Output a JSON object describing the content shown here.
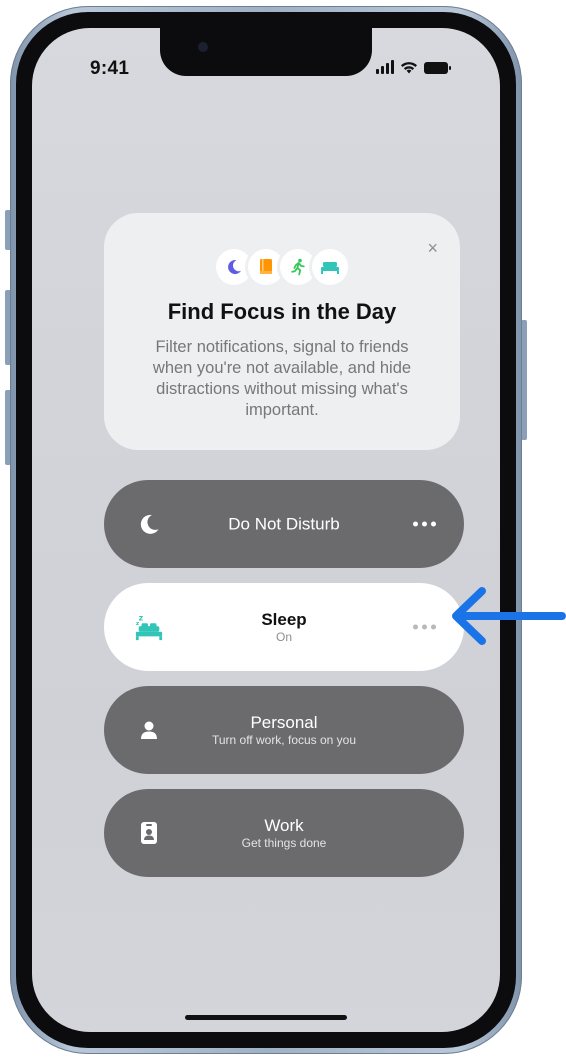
{
  "status": {
    "time": "9:41"
  },
  "focus_card": {
    "title": "Find Focus in the Day",
    "body": "Filter notifications, signal to friends when you're not available, and hide distractions without missing what's important.",
    "close_label": "×",
    "icons": [
      "moon-icon",
      "book-icon",
      "running-figure-icon",
      "bed-icon"
    ]
  },
  "focus_modes": [
    {
      "name": "Do Not Disturb",
      "subtitle": "",
      "icon": "moon-icon",
      "active": false
    },
    {
      "name": "Sleep",
      "subtitle": "On",
      "icon": "bed-icon",
      "active": true
    },
    {
      "name": "Personal",
      "subtitle": "Turn off work, focus on you",
      "icon": "person-icon",
      "active": false
    },
    {
      "name": "Work",
      "subtitle": "Get things done",
      "icon": "id-badge-icon",
      "active": false
    }
  ],
  "colors": {
    "moon": "#5e5ce6",
    "book": "#ff9500",
    "running": "#34c759",
    "bed": "#30c5b7",
    "arrow": "#1a74e8",
    "row_inactive": "#6b6b6e",
    "row_active": "#ffffff"
  }
}
